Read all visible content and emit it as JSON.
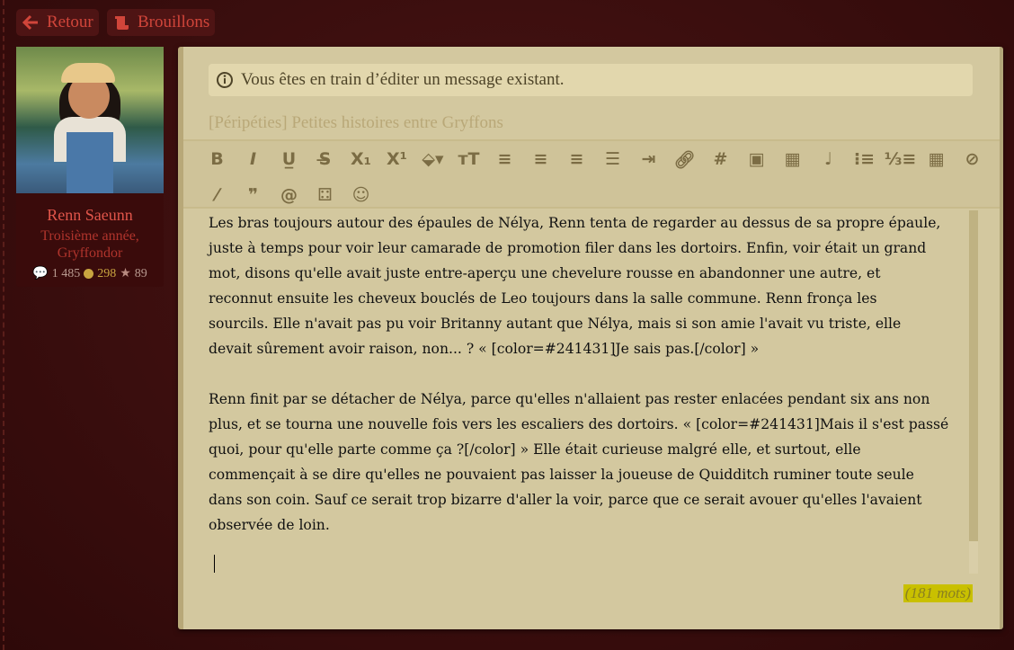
{
  "nav": {
    "back_label": "Retour",
    "drafts_label": "Brouillons"
  },
  "profile": {
    "name": "Renn Saeunn",
    "rank_line1": "Troisième année,",
    "rank_line2": "Gryffondor",
    "messages": "1 485",
    "coins": "298",
    "stars": "89"
  },
  "editor": {
    "info": "Vous êtes en train d’éditer un message existant.",
    "subject": "[Péripéties] Petites histoires entre Gryffons",
    "toolbar": [
      "bold",
      "italic",
      "underline",
      "strikethrough",
      "subscript",
      "superscript",
      "fill-color",
      "font-size",
      "align-left",
      "align-center",
      "align-right",
      "justify",
      "indent",
      "link",
      "hashtag",
      "image",
      "video",
      "music",
      "bullet-list",
      "numbered-list",
      "table",
      "hide",
      "magic-wand",
      "quote",
      "mention",
      "dice",
      "emoji"
    ],
    "lines": [
      "Les bras toujours autour des épaules de Nélya, Renn tenta de regarder au dessus de sa propre épaule,",
      "juste à temps pour voir leur camarade de promotion filer dans les dortoirs. Enfin, voir était un grand",
      "mot, disons qu'elle avait juste entre-aperçu une chevelure rousse en abandonner une autre, et",
      "reconnut ensuite les cheveux bouclés de Leo toujours dans la salle commune. Renn fronça les",
      "sourcils. Elle n'avait pas pu voir Britanny autant que Nélya, mais si son amie l'avait vu triste, elle",
      "devait sûrement avoir raison, non... ? « [color=#241431]Je sais pas.[/color] »",
      "",
      "Renn finit par se détacher de Nélya, parce qu'elles n'allaient pas rester enlacées pendant six ans non",
      "plus, et se tourna une nouvelle fois vers les escaliers des dortoirs. « [color=#241431]Mais il s'est passé",
      "quoi, pour qu'elle parte comme ça ?[/color] » Elle était curieuse malgré elle, et surtout, elle",
      "commençait à se dire qu'elles ne pouvaient pas laisser la joueuse de Quidditch ruminer toute seule",
      "dans son coin. Sauf ce serait trop bizarre d'aller la voir, parce que ce serait avouer qu'elles l'avaient",
      "observée de loin."
    ],
    "word_count": "(181 mots)"
  }
}
